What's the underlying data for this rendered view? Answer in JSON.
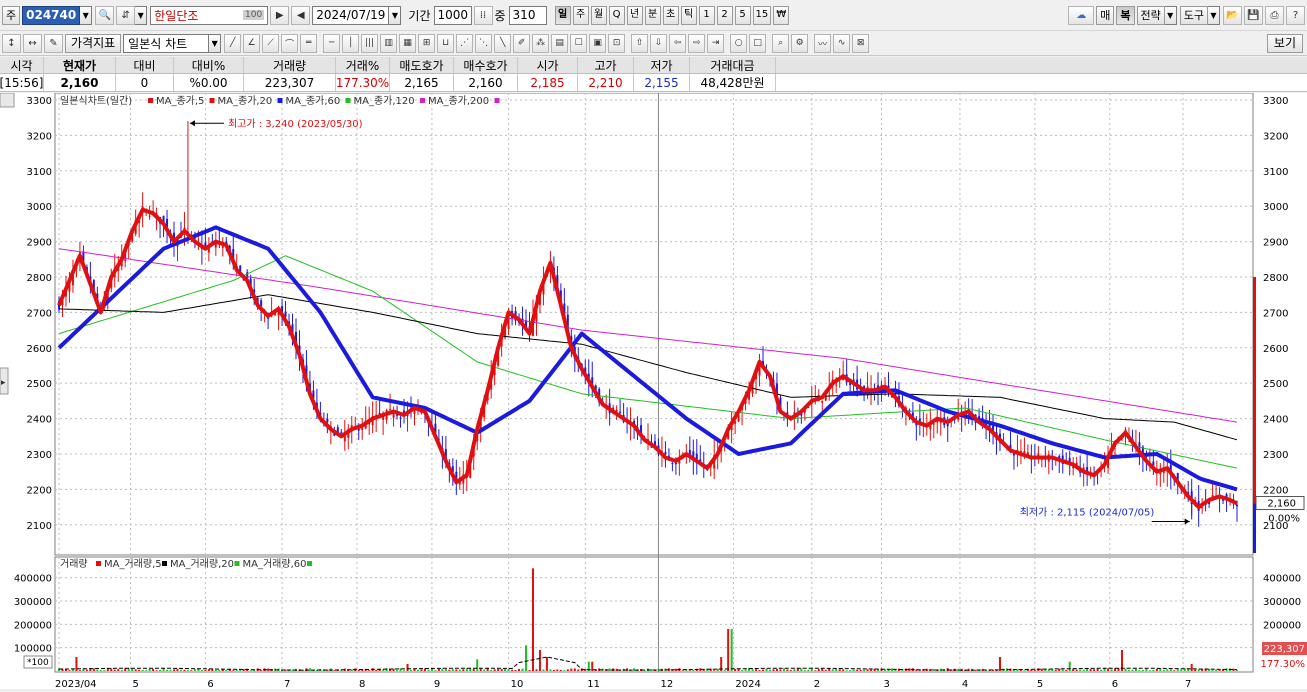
{
  "toolbar": {
    "market": "주",
    "stock_code": "024740",
    "stock_name": "한일단조",
    "name_badge": "100",
    "date": "2024/07/19",
    "period_label": "기간",
    "period_value": "1000",
    "overlap_label": "중",
    "overlap_value": "310",
    "timeframes": [
      "일",
      "주",
      "월",
      "Q",
      "년",
      "분",
      "초",
      "틱",
      "1",
      "2",
      "5",
      "15",
      "₩"
    ],
    "active_timeframe": "일",
    "right_buttons": [
      "매",
      "복",
      "전략",
      "도구"
    ]
  },
  "toolbar2": {
    "indicator_button": "가격지표",
    "chart_type": "일본식 차트",
    "view_button": "보기"
  },
  "quote": {
    "headers": [
      "시각",
      "현재가",
      "대비",
      "대비%",
      "거래량",
      "거래%",
      "매도호가",
      "매수호가",
      "시가",
      "고가",
      "저가",
      "거래대금"
    ],
    "values": [
      "[15:56]",
      "2,160",
      "0",
      "%0.00",
      "223,307",
      "177.30%",
      "2,165",
      "2,160",
      "2,185",
      "2,210",
      "2,155",
      "48,428만원"
    ],
    "colors": [
      "#000000",
      "#000000",
      "#000000",
      "#000000",
      "#000000",
      "#d40000",
      "#000000",
      "#000000",
      "#d40000",
      "#d40000",
      "#1a2bd0",
      "#000000"
    ]
  },
  "price_legend": {
    "title": "일본식차트(일간)",
    "items": [
      {
        "label": "MA_종가,5",
        "color": "#e01010"
      },
      {
        "label": "MA_종가,20",
        "color": "#e01010"
      },
      {
        "label": "MA_종가,60",
        "color": "#1a1ae0"
      },
      {
        "label": "MA_종가,120",
        "color": "#20c020"
      },
      {
        "label": "MA_종가,200",
        "color": "#d020d0"
      }
    ]
  },
  "volume_legend": {
    "title": "거래량",
    "items": [
      {
        "label": "MA_거래량,5",
        "color": "#e01010"
      },
      {
        "label": "MA_거래량,20",
        "color": "#000000"
      },
      {
        "label": "MA_거래량,60",
        "color": "#20c020"
      }
    ]
  },
  "annotations": {
    "high": "최고가 : 3,240 (2023/05/30)",
    "low": "최저가 : 2,115 (2024/07/05)",
    "current_price": "2,160",
    "current_change": "0.00%",
    "current_volume": "223,307",
    "volume_ratio": "177.30%",
    "volume_unit": "*100"
  },
  "chart_data": [
    {
      "type": "candlestick",
      "title": "일본식차트(일간)",
      "x_tick_labels": [
        "2023/04",
        "5",
        "6",
        "7",
        "8",
        "9",
        "10",
        "11",
        "12",
        "2024",
        "2",
        "3",
        "4",
        "5",
        "6",
        "7"
      ],
      "y_ticks": [
        2100,
        2200,
        2300,
        2400,
        2500,
        2600,
        2700,
        2800,
        2900,
        3000,
        3100,
        3200,
        3300
      ],
      "ylim": [
        2040,
        3300
      ],
      "grid": true,
      "close_path": [
        [
          0,
          2720
        ],
        [
          6,
          2790
        ],
        [
          12,
          2860
        ],
        [
          18,
          2780
        ],
        [
          24,
          2700
        ],
        [
          30,
          2800
        ],
        [
          36,
          2850
        ],
        [
          42,
          2930
        ],
        [
          48,
          2990
        ],
        [
          54,
          2980
        ],
        [
          60,
          2950
        ],
        [
          66,
          2900
        ],
        [
          72,
          2930
        ],
        [
          78,
          2900
        ],
        [
          84,
          2880
        ],
        [
          90,
          2900
        ],
        [
          96,
          2890
        ],
        [
          102,
          2820
        ],
        [
          108,
          2790
        ],
        [
          114,
          2720
        ],
        [
          120,
          2690
        ],
        [
          126,
          2710
        ],
        [
          132,
          2660
        ],
        [
          138,
          2580
        ],
        [
          144,
          2470
        ],
        [
          150,
          2400
        ],
        [
          156,
          2370
        ],
        [
          162,
          2350
        ],
        [
          168,
          2370
        ],
        [
          174,
          2380
        ],
        [
          180,
          2400
        ],
        [
          186,
          2410
        ],
        [
          192,
          2420
        ],
        [
          198,
          2410
        ],
        [
          204,
          2430
        ],
        [
          210,
          2420
        ],
        [
          216,
          2350
        ],
        [
          222,
          2280
        ],
        [
          228,
          2220
        ],
        [
          234,
          2240
        ],
        [
          240,
          2370
        ],
        [
          246,
          2480
        ],
        [
          252,
          2600
        ],
        [
          258,
          2700
        ],
        [
          264,
          2680
        ],
        [
          270,
          2640
        ],
        [
          276,
          2760
        ],
        [
          282,
          2840
        ],
        [
          288,
          2720
        ],
        [
          294,
          2600
        ],
        [
          300,
          2540
        ],
        [
          306,
          2490
        ],
        [
          312,
          2440
        ],
        [
          318,
          2420
        ],
        [
          324,
          2400
        ],
        [
          330,
          2380
        ],
        [
          336,
          2340
        ],
        [
          342,
          2320
        ],
        [
          348,
          2290
        ],
        [
          354,
          2280
        ],
        [
          360,
          2300
        ],
        [
          366,
          2280
        ],
        [
          372,
          2260
        ],
        [
          378,
          2300
        ],
        [
          384,
          2370
        ],
        [
          390,
          2420
        ],
        [
          396,
          2480
        ],
        [
          402,
          2560
        ],
        [
          408,
          2520
        ],
        [
          414,
          2420
        ],
        [
          420,
          2400
        ],
        [
          426,
          2420
        ],
        [
          432,
          2450
        ],
        [
          438,
          2460
        ],
        [
          444,
          2500
        ],
        [
          450,
          2520
        ],
        [
          456,
          2500
        ],
        [
          462,
          2480
        ],
        [
          468,
          2480
        ],
        [
          474,
          2490
        ],
        [
          480,
          2460
        ],
        [
          486,
          2420
        ],
        [
          492,
          2390
        ],
        [
          498,
          2380
        ],
        [
          504,
          2400
        ],
        [
          510,
          2390
        ],
        [
          516,
          2410
        ],
        [
          522,
          2420
        ],
        [
          528,
          2390
        ],
        [
          534,
          2370
        ],
        [
          540,
          2340
        ],
        [
          546,
          2310
        ],
        [
          552,
          2300
        ],
        [
          558,
          2290
        ],
        [
          564,
          2290
        ],
        [
          570,
          2290
        ],
        [
          576,
          2280
        ],
        [
          582,
          2270
        ],
        [
          588,
          2250
        ],
        [
          594,
          2240
        ],
        [
          600,
          2270
        ],
        [
          606,
          2330
        ],
        [
          612,
          2360
        ],
        [
          618,
          2320
        ],
        [
          624,
          2280
        ],
        [
          630,
          2250
        ],
        [
          636,
          2260
        ],
        [
          642,
          2220
        ],
        [
          648,
          2180
        ],
        [
          654,
          2150
        ],
        [
          660,
          2170
        ],
        [
          666,
          2180
        ],
        [
          672,
          2170
        ],
        [
          676,
          2160
        ]
      ],
      "ma_200_path": [
        [
          0,
          2880
        ],
        [
          150,
          2770
        ],
        [
          300,
          2650
        ],
        [
          450,
          2570
        ],
        [
          550,
          2490
        ],
        [
          676,
          2390
        ]
      ],
      "ma_120_path": [
        [
          0,
          2640
        ],
        [
          100,
          2790
        ],
        [
          130,
          2860
        ],
        [
          180,
          2760
        ],
        [
          240,
          2560
        ],
        [
          300,
          2470
        ],
        [
          420,
          2400
        ],
        [
          520,
          2430
        ],
        [
          600,
          2340
        ],
        [
          676,
          2260
        ]
      ],
      "ma_60_path": [
        [
          0,
          2600
        ],
        [
          30,
          2740
        ],
        [
          60,
          2880
        ],
        [
          90,
          2940
        ],
        [
          120,
          2880
        ],
        [
          150,
          2700
        ],
        [
          180,
          2460
        ],
        [
          210,
          2430
        ],
        [
          240,
          2360
        ],
        [
          270,
          2450
        ],
        [
          300,
          2640
        ],
        [
          330,
          2520
        ],
        [
          360,
          2400
        ],
        [
          390,
          2300
        ],
        [
          420,
          2330
        ],
        [
          450,
          2470
        ],
        [
          480,
          2480
        ],
        [
          510,
          2420
        ],
        [
          540,
          2380
        ],
        [
          570,
          2330
        ],
        [
          600,
          2290
        ],
        [
          630,
          2300
        ],
        [
          655,
          2230
        ],
        [
          676,
          2200
        ]
      ],
      "ma_black_path": [
        [
          0,
          2710
        ],
        [
          60,
          2700
        ],
        [
          120,
          2750
        ],
        [
          180,
          2700
        ],
        [
          240,
          2640
        ],
        [
          300,
          2610
        ],
        [
          360,
          2530
        ],
        [
          420,
          2460
        ],
        [
          480,
          2470
        ],
        [
          540,
          2460
        ],
        [
          600,
          2400
        ],
        [
          640,
          2390
        ],
        [
          676,
          2340
        ]
      ],
      "high": {
        "value": 3240,
        "date": "2023/05/30"
      },
      "low": {
        "value": 2115,
        "date": "2024/07/05"
      },
      "last": 2160
    },
    {
      "type": "bar",
      "title": "거래량",
      "y_ticks": [
        100000,
        200000,
        300000,
        400000
      ],
      "ylim": [
        0,
        450000
      ],
      "unit": "*100",
      "spikes": [
        [
          10,
          60000
        ],
        [
          200,
          30000
        ],
        [
          240,
          50000
        ],
        [
          268,
          110000
        ],
        [
          272,
          440000
        ],
        [
          276,
          90000
        ],
        [
          280,
          60000
        ],
        [
          305,
          40000
        ],
        [
          380,
          60000
        ],
        [
          385,
          180000
        ],
        [
          540,
          60000
        ],
        [
          580,
          40000
        ],
        [
          610,
          90000
        ],
        [
          650,
          30000
        ]
      ],
      "last": 223307
    }
  ]
}
